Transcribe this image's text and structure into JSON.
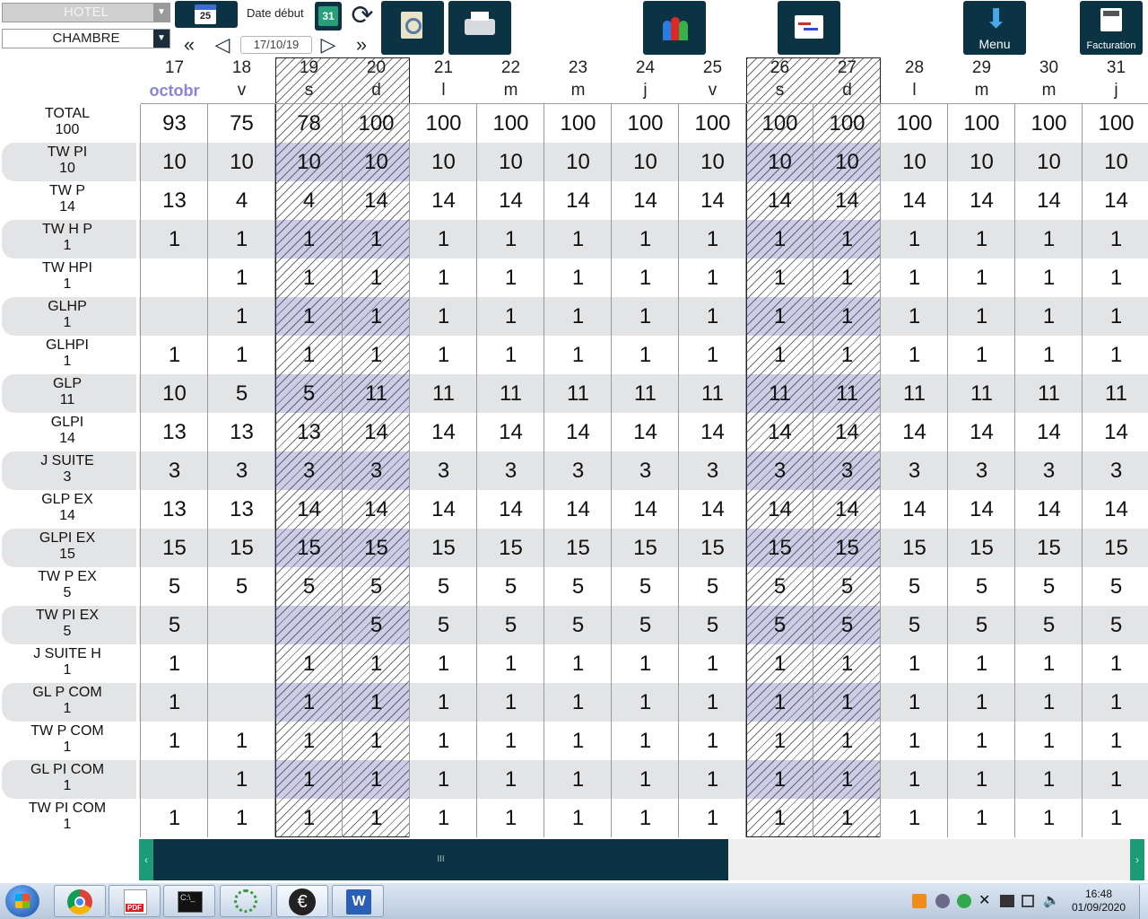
{
  "toolbar": {
    "hotel_select": "HOTEL",
    "room_select": "CHAMBRE",
    "date_label": "Date début",
    "calendar_day": "25",
    "day31_label": "31",
    "date_value": "17/10/19",
    "menu_label": "Menu",
    "billing_label": "Facturation"
  },
  "grid": {
    "columns": [
      {
        "day": "17",
        "dow": "octobr"
      },
      {
        "day": "18",
        "dow": "v"
      },
      {
        "day": "19",
        "dow": "s"
      },
      {
        "day": "20",
        "dow": "d"
      },
      {
        "day": "21",
        "dow": "l"
      },
      {
        "day": "22",
        "dow": "m"
      },
      {
        "day": "23",
        "dow": "m"
      },
      {
        "day": "24",
        "dow": "j"
      },
      {
        "day": "25",
        "dow": "v"
      },
      {
        "day": "26",
        "dow": "s"
      },
      {
        "day": "27",
        "dow": "d"
      },
      {
        "day": "28",
        "dow": "l"
      },
      {
        "day": "29",
        "dow": "m"
      },
      {
        "day": "30",
        "dow": "m"
      },
      {
        "day": "31",
        "dow": "j"
      }
    ],
    "weekend_columns": [
      2,
      3,
      9,
      10
    ],
    "rows": [
      {
        "name": "TOTAL",
        "capacity": "100",
        "values": [
          "93",
          "75",
          "78",
          "100",
          "100",
          "100",
          "100",
          "100",
          "100",
          "100",
          "100",
          "100",
          "100",
          "100",
          "100"
        ]
      },
      {
        "name": "TW PI",
        "capacity": "10",
        "values": [
          "10",
          "10",
          "10",
          "10",
          "10",
          "10",
          "10",
          "10",
          "10",
          "10",
          "10",
          "10",
          "10",
          "10",
          "10"
        ]
      },
      {
        "name": "TW P",
        "capacity": "14",
        "values": [
          "13",
          "4",
          "4",
          "14",
          "14",
          "14",
          "14",
          "14",
          "14",
          "14",
          "14",
          "14",
          "14",
          "14",
          "14"
        ]
      },
      {
        "name": "TW H P",
        "capacity": "1",
        "values": [
          "1",
          "1",
          "1",
          "1",
          "1",
          "1",
          "1",
          "1",
          "1",
          "1",
          "1",
          "1",
          "1",
          "1",
          "1"
        ]
      },
      {
        "name": "TW HPI",
        "capacity": "1",
        "values": [
          "",
          "1",
          "1",
          "1",
          "1",
          "1",
          "1",
          "1",
          "1",
          "1",
          "1",
          "1",
          "1",
          "1",
          "1"
        ]
      },
      {
        "name": "GLHP",
        "capacity": "1",
        "values": [
          "",
          "1",
          "1",
          "1",
          "1",
          "1",
          "1",
          "1",
          "1",
          "1",
          "1",
          "1",
          "1",
          "1",
          "1"
        ]
      },
      {
        "name": "GLHPI",
        "capacity": "1",
        "values": [
          "1",
          "1",
          "1",
          "1",
          "1",
          "1",
          "1",
          "1",
          "1",
          "1",
          "1",
          "1",
          "1",
          "1",
          "1"
        ]
      },
      {
        "name": "GLP",
        "capacity": "11",
        "values": [
          "10",
          "5",
          "5",
          "11",
          "11",
          "11",
          "11",
          "11",
          "11",
          "11",
          "11",
          "11",
          "11",
          "11",
          "11"
        ]
      },
      {
        "name": "GLPI",
        "capacity": "14",
        "values": [
          "13",
          "13",
          "13",
          "14",
          "14",
          "14",
          "14",
          "14",
          "14",
          "14",
          "14",
          "14",
          "14",
          "14",
          "14"
        ]
      },
      {
        "name": "J SUITE",
        "capacity": "3",
        "values": [
          "3",
          "3",
          "3",
          "3",
          "3",
          "3",
          "3",
          "3",
          "3",
          "3",
          "3",
          "3",
          "3",
          "3",
          "3"
        ]
      },
      {
        "name": "GLP EX",
        "capacity": "14",
        "values": [
          "13",
          "13",
          "14",
          "14",
          "14",
          "14",
          "14",
          "14",
          "14",
          "14",
          "14",
          "14",
          "14",
          "14",
          "14"
        ]
      },
      {
        "name": "GLPI EX",
        "capacity": "15",
        "values": [
          "15",
          "15",
          "15",
          "15",
          "15",
          "15",
          "15",
          "15",
          "15",
          "15",
          "15",
          "15",
          "15",
          "15",
          "15"
        ]
      },
      {
        "name": "TW P EX",
        "capacity": "5",
        "values": [
          "5",
          "5",
          "5",
          "5",
          "5",
          "5",
          "5",
          "5",
          "5",
          "5",
          "5",
          "5",
          "5",
          "5",
          "5"
        ]
      },
      {
        "name": "TW PI EX",
        "capacity": "5",
        "values": [
          "5",
          "",
          "",
          "5",
          "5",
          "5",
          "5",
          "5",
          "5",
          "5",
          "5",
          "5",
          "5",
          "5",
          "5"
        ]
      },
      {
        "name": "J SUITE H",
        "capacity": "1",
        "values": [
          "1",
          "",
          "1",
          "1",
          "1",
          "1",
          "1",
          "1",
          "1",
          "1",
          "1",
          "1",
          "1",
          "1",
          "1"
        ]
      },
      {
        "name": "GL P COM",
        "capacity": "1",
        "values": [
          "1",
          "",
          "1",
          "1",
          "1",
          "1",
          "1",
          "1",
          "1",
          "1",
          "1",
          "1",
          "1",
          "1",
          "1"
        ]
      },
      {
        "name": "TW P COM",
        "capacity": "1",
        "values": [
          "1",
          "1",
          "1",
          "1",
          "1",
          "1",
          "1",
          "1",
          "1",
          "1",
          "1",
          "1",
          "1",
          "1",
          "1"
        ]
      },
      {
        "name": "GL PI COM",
        "capacity": "1",
        "values": [
          "",
          "1",
          "1",
          "1",
          "1",
          "1",
          "1",
          "1",
          "1",
          "1",
          "1",
          "1",
          "1",
          "1",
          "1"
        ]
      },
      {
        "name": "TW PI COM",
        "capacity": "1",
        "values": [
          "1",
          "1",
          "1",
          "1",
          "1",
          "1",
          "1",
          "1",
          "1",
          "1",
          "1",
          "1",
          "1",
          "1",
          "1"
        ]
      }
    ]
  },
  "scrollbar": {
    "grip": "III"
  },
  "taskbar": {
    "time": "16:48",
    "date": "01/09/2020",
    "pdf_label": "PDF"
  },
  "colors": {
    "toolbar_dark": "#0c3344",
    "row_stripe": "#e3e4e6",
    "month": "#8a84d6",
    "scroll_green": "#1d9a76"
  }
}
